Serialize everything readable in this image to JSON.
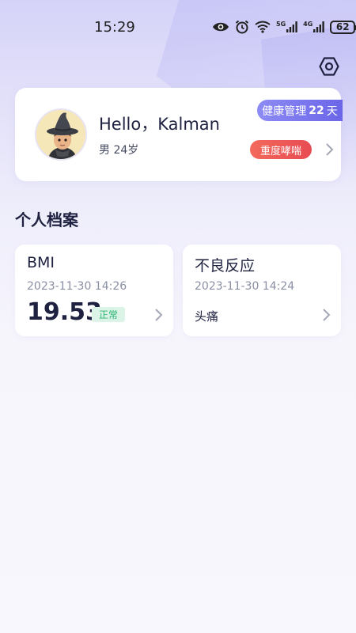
{
  "status_bar": {
    "time": "15:29",
    "signal1_label": "5G",
    "signal2_label": "4G",
    "battery": "62"
  },
  "profile": {
    "greeting": "Hello，Kalman",
    "sub_info": "男 24岁",
    "days_label": "健康管理",
    "days_value": "22",
    "days_unit": "天",
    "condition": "重度哮喘"
  },
  "section": {
    "title": "个人档案"
  },
  "cards": {
    "bmi": {
      "title": "BMI",
      "date": "2023-11-30 14:26",
      "value": "19.53",
      "tag": "正常"
    },
    "reaction": {
      "title": "不良反应",
      "date": "2023-11-30 14:24",
      "value": "头痛"
    }
  },
  "colors": {
    "accent": "#6b66e8",
    "danger": "#e84b53",
    "normal": "#2bb673"
  }
}
